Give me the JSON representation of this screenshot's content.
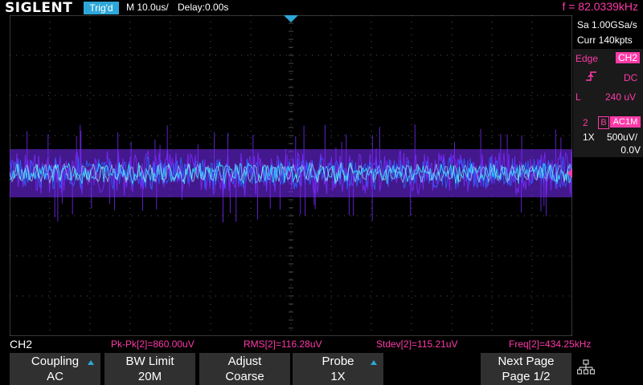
{
  "header": {
    "brand": "SIGLENT",
    "trigger_status": "Trig'd",
    "timebase": "M 10.0us/",
    "delay": "Delay:0.00s",
    "frequency": "f = 82.0339kHz"
  },
  "acquisition": {
    "sample_rate": "Sa 1.00GSa/s",
    "memory_depth": "Curr 140kpts"
  },
  "trigger": {
    "type": "Edge",
    "source": "CH2",
    "slope_icon": "rising-edge-icon",
    "coupling": "DC",
    "level_label": "L",
    "level": "240 uV"
  },
  "channel": {
    "number": "2",
    "bandwidth_flag": "B",
    "coupling": "AC1M",
    "probe": "1X",
    "volts_per_div": "500uV/",
    "offset": "0.0V",
    "marker": "2",
    "color": "#ff3aa8"
  },
  "measurements": {
    "channel": "CH2",
    "pkpk": "Pk-Pk[2]=860.00uV",
    "rms": "RMS[2]=116.28uV",
    "stdev": "Stdev[2]=115.21uV",
    "freq": "Freq[2]=434.25kHz"
  },
  "softkeys": [
    {
      "title": "Coupling",
      "value": "AC"
    },
    {
      "title": "BW Limit",
      "value": "20M"
    },
    {
      "title": "Adjust",
      "value": "Coarse"
    },
    {
      "title": "Probe",
      "value": "1X"
    },
    {
      "title": "",
      "value": ""
    },
    {
      "title": "Next Page",
      "value": "Page 1/2"
    }
  ],
  "colors": {
    "accent": "#2ea7d8",
    "channel2": "#ff3aa8",
    "trace_core": "#33e0ff",
    "trace_mid": "#2a63ff",
    "trace_outer": "#7a2bff"
  }
}
